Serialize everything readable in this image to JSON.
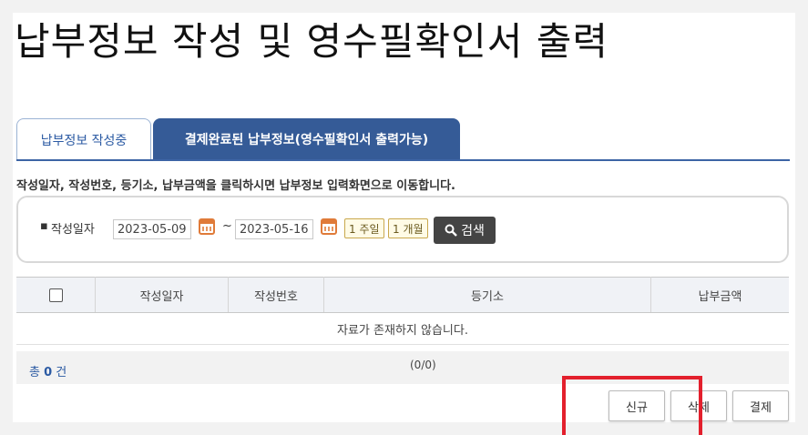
{
  "page": {
    "title": "납부정보 작성 및 영수필확인서 출력"
  },
  "tabs": [
    {
      "label": "납부정보 작성중",
      "active": true
    },
    {
      "label": "결제완료된 납부정보(영수필확인서 출력가능)",
      "active": false
    }
  ],
  "info_text": "작성일자, 작성번호, 등기소, 납부금액을 클릭하시면 납부정보 입력화면으로 이동합니다.",
  "search": {
    "bullet": "▪",
    "label": "작성일자",
    "date_from": "2023-05-09",
    "date_to": "2023-05-16",
    "tilde": "~",
    "period_1week": "1 주일",
    "period_1month": "1 개월",
    "search_button": "검색",
    "calendar_icon": "calendar-icon",
    "search_icon": "search-icon",
    "accent": "#e07b39"
  },
  "table": {
    "headers": [
      "작성일자",
      "작성번호",
      "등기소",
      "납부금액"
    ],
    "empty_message": "자료가 존재하지 않습니다."
  },
  "footer": {
    "total_prefix": "총",
    "total_count": "0",
    "total_suffix": "건",
    "pagination": "(0/0)"
  },
  "actions": {
    "new": "신규",
    "delete": "삭제",
    "pay": "결제"
  },
  "colors": {
    "tab_active_text": "#2b5aa3",
    "tab_inactive_bg": "#355b97",
    "highlight": "#e3202d"
  }
}
